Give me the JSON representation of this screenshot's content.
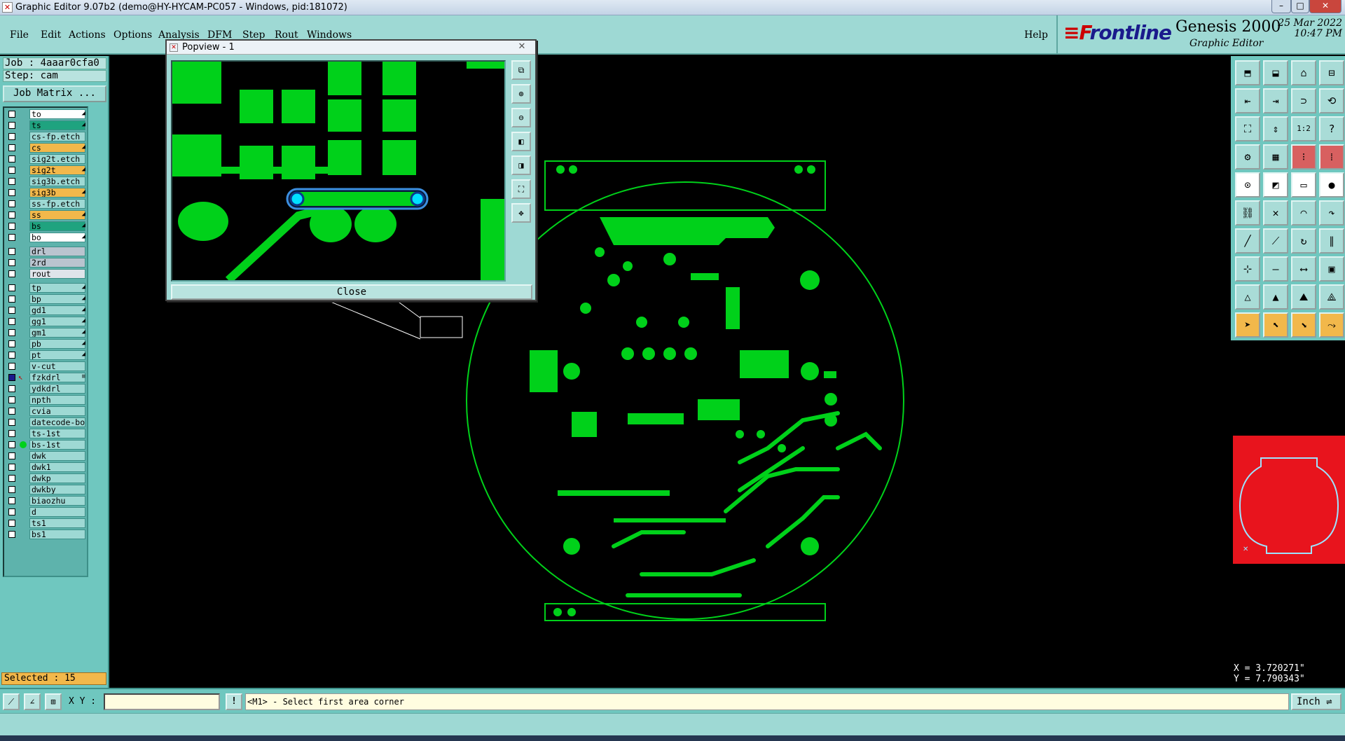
{
  "window": {
    "title": "Graphic Editor 9.07b2 (demo@HY-HYCAM-PC057 - Windows, pid:181072)",
    "minimize": "–",
    "maximize": "□",
    "close": "✕"
  },
  "menu": {
    "items": [
      "File",
      "Edit",
      "Actions",
      "Options",
      "Analysis",
      "DFM",
      "Step",
      "Rout",
      "Windows"
    ],
    "help": "Help"
  },
  "brand": {
    "logo_f": "≡F",
    "logo_rest": "rontline",
    "product": "Genesis 2000",
    "subtitle": "Graphic Editor",
    "date": "25 Mar 2022",
    "time": "10:47 PM"
  },
  "job": {
    "job_label": "Job : 4aaar0cfa0",
    "step_label": "Step: cam",
    "matrix_button": "Job Matrix ..."
  },
  "layers": [
    {
      "name": "to",
      "color": "#ffffff",
      "arrow": "◢"
    },
    {
      "name": "ts",
      "color": "#1fa37f",
      "arrow": "◢"
    },
    {
      "name": "cs-fp.etch",
      "color": "#9ed9d4",
      "arrow": ""
    },
    {
      "name": "cs",
      "color": "#f2b84b",
      "arrow": "◢"
    },
    {
      "name": "sig2t.etch",
      "color": "#9ed9d4",
      "arrow": ""
    },
    {
      "name": "sig2t",
      "color": "#f2b84b",
      "arrow": "◢"
    },
    {
      "name": "sig3b.etch",
      "color": "#9ed9d4",
      "arrow": ""
    },
    {
      "name": "sig3b",
      "color": "#f2b84b",
      "arrow": "◢"
    },
    {
      "name": "ss-fp.etch",
      "color": "#9ed9d4",
      "arrow": ""
    },
    {
      "name": "ss",
      "color": "#f2b84b",
      "arrow": "◢"
    },
    {
      "name": "bs",
      "color": "#1fa37f",
      "arrow": "◢"
    },
    {
      "name": "bo",
      "color": "#ffffff",
      "arrow": "◢"
    },
    {
      "name": "drl",
      "color": "#b9c4cf",
      "arrow": ""
    },
    {
      "name": "2rd",
      "color": "#b9c4cf",
      "arrow": ""
    },
    {
      "name": "rout",
      "color": "#dfe4ea",
      "arrow": ""
    },
    {
      "name": "tp",
      "color": "#9ed9d4",
      "arrow": "◢"
    },
    {
      "name": "bp",
      "color": "#9ed9d4",
      "arrow": "◢"
    },
    {
      "name": "gd1",
      "color": "#9ed9d4",
      "arrow": "◢"
    },
    {
      "name": "gg1",
      "color": "#9ed9d4",
      "arrow": "◢"
    },
    {
      "name": "gm1",
      "color": "#9ed9d4",
      "arrow": "◢"
    },
    {
      "name": "pb",
      "color": "#9ed9d4",
      "arrow": "◢"
    },
    {
      "name": "pt",
      "color": "#9ed9d4",
      "arrow": "◢"
    },
    {
      "name": "v-cut",
      "color": "#9ed9d4",
      "arrow": ""
    },
    {
      "name": "fzkdrl",
      "color": "#9ed9d4",
      "arrow": "≡"
    },
    {
      "name": "ydkdrl",
      "color": "#9ed9d4",
      "arrow": ""
    },
    {
      "name": "npth",
      "color": "#9ed9d4",
      "arrow": ""
    },
    {
      "name": "cvia",
      "color": "#9ed9d4",
      "arrow": ""
    },
    {
      "name": "datecode-bo",
      "color": "#9ed9d4",
      "arrow": ""
    },
    {
      "name": "ts-1st",
      "color": "#9ed9d4",
      "arrow": ""
    },
    {
      "name": "bs-1st",
      "color": "#9ed9d4",
      "arrow": ""
    },
    {
      "name": "dwk",
      "color": "#9ed9d4",
      "arrow": ""
    },
    {
      "name": "dwk1",
      "color": "#9ed9d4",
      "arrow": ""
    },
    {
      "name": "dwkp",
      "color": "#9ed9d4",
      "arrow": ""
    },
    {
      "name": "dwkby",
      "color": "#9ed9d4",
      "arrow": ""
    },
    {
      "name": "biaozhu",
      "color": "#9ed9d4",
      "arrow": ""
    },
    {
      "name": "d",
      "color": "#9ed9d4",
      "arrow": ""
    },
    {
      "name": "ts1",
      "color": "#9ed9d4",
      "arrow": ""
    },
    {
      "name": "bs1",
      "color": "#9ed9d4",
      "arrow": ""
    }
  ],
  "status": {
    "selected": "Selected : 15"
  },
  "popview": {
    "title": "Popview - 1",
    "close_x": "✕",
    "close_button": "Close"
  },
  "bottom": {
    "xy_label": "X Y :",
    "xy_value": "",
    "message_icon": "!",
    "message": "<M1> - Select first area corner",
    "unit": "Inch ⇌"
  },
  "coords": {
    "x": "X = 3.720271\"",
    "y": "Y = 7.790343\""
  },
  "colors": {
    "trace": "#00d11a",
    "panel": "#6fc7bf",
    "menubar": "#9ed9d4",
    "highlight": "#f2b84b",
    "minimap": "#e8141d"
  },
  "toolbar_icons": [
    "window-in-icon",
    "window-out-icon",
    "home-icon",
    "split-icon",
    "zoom-in-left-icon",
    "zoom-out-right-icon",
    "pan-icon",
    "redraw-icon",
    "fit-icon",
    "fit-vertical-icon",
    "scale-1-2-icon",
    "help-icon",
    "layer-stack-icon",
    "grid-icon",
    "pads-icon",
    "snap-icon",
    "pad-add-icon",
    "surface-icon",
    "ruler-icon",
    "circle-fill-icon",
    "node-link-icon",
    "cross-node-icon",
    "arc-icon",
    "arc-arrow-icon",
    "line-red-icon",
    "diagonal-line-icon",
    "rotate-icon",
    "parallel-icon",
    "move-icon",
    "horizontal-line-icon",
    "measure-icon",
    "square-icons",
    "triangle-icon",
    "triangle-2-icon",
    "triangle-3-icon",
    "triangle-4-icon",
    "pointer-icon",
    "pointer-select-icon",
    "pointer-move-icon",
    "pointer-route-icon"
  ]
}
